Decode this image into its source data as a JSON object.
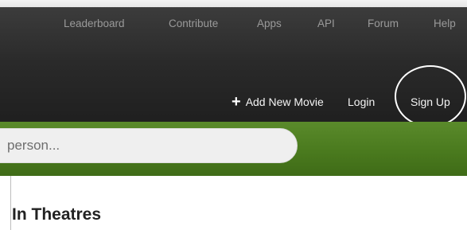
{
  "topnav": {
    "items": [
      {
        "label": "Leaderboard"
      },
      {
        "label": "Contribute"
      },
      {
        "label": "Apps"
      },
      {
        "label": "API"
      },
      {
        "label": "Forum"
      },
      {
        "label": "Help"
      }
    ]
  },
  "actions": {
    "add_movie_label": "Add New Movie",
    "plus_glyph": "+",
    "login_label": "Login",
    "signup_label": "Sign Up"
  },
  "search": {
    "placeholder": "person..."
  },
  "content": {
    "section_title": "In Theatres"
  },
  "colors": {
    "header_dark": "#2a2a2a",
    "green_bar": "#4a7a1e",
    "nav_text": "#9a9a9a",
    "action_text": "#f4f4f4"
  },
  "icons": {
    "add": "plus-icon",
    "highlight": "signup-highlight-circle"
  }
}
